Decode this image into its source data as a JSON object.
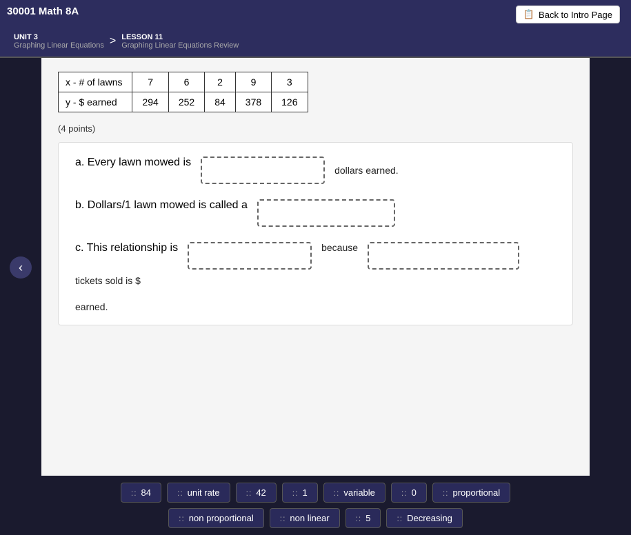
{
  "app": {
    "title": "30001 Math 8A"
  },
  "header": {
    "back_button": "Back to Intro Page",
    "unit_label": "UNIT 3",
    "unit_name": "Graphing Linear Equations",
    "lesson_label": "LESSON 11",
    "lesson_name": "Graphing Linear Equations Review",
    "chevron": ">"
  },
  "table": {
    "row1_label": "x - # of lawns",
    "row1_values": [
      "7",
      "6",
      "2",
      "9",
      "3"
    ],
    "row2_label": "y - $ earned",
    "row2_values": [
      "294",
      "252",
      "84",
      "378",
      "126"
    ]
  },
  "points": "(4 points)",
  "questions": [
    {
      "id": "a",
      "prefix": "a.  Every lawn mowed is",
      "suffix": "dollars earned.",
      "answer_size": "normal"
    },
    {
      "id": "b",
      "prefix": "b.  Dollars/1 lawn mowed is called a",
      "suffix": "",
      "answer_size": "normal"
    },
    {
      "id": "c",
      "prefix": "c.  This relationship is",
      "middle": "because",
      "suffix": "tickets sold is $",
      "answer_size": "normal"
    }
  ],
  "earned_label": "earned.",
  "drag_items_row1": [
    {
      "label": "84",
      "dots": "::"
    },
    {
      "label": "unit rate",
      "dots": "::"
    },
    {
      "label": "42",
      "dots": "::"
    },
    {
      "label": "1",
      "dots": "::"
    },
    {
      "label": "variable",
      "dots": "::"
    },
    {
      "label": "0",
      "dots": "::"
    },
    {
      "label": "proportional",
      "dots": "::"
    }
  ],
  "drag_items_row2": [
    {
      "label": "non proportional",
      "dots": "::"
    },
    {
      "label": "non linear",
      "dots": "::"
    },
    {
      "label": "5",
      "dots": "::"
    },
    {
      "label": "Decreasing",
      "dots": "::"
    }
  ]
}
